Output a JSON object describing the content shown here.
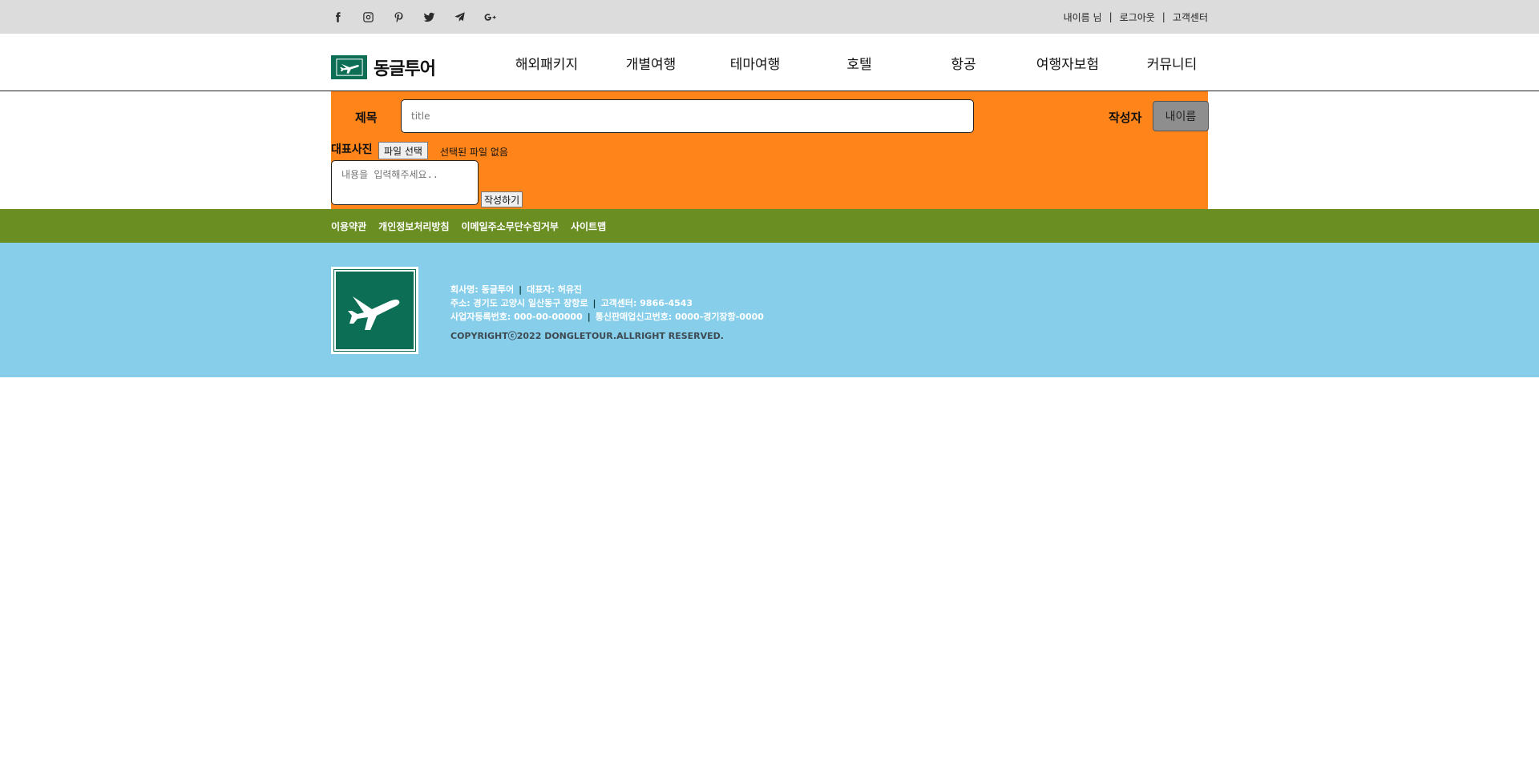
{
  "topbar": {
    "social_icons": [
      "facebook-icon",
      "instagram-icon",
      "pinterest-icon",
      "twitter-icon",
      "telegram-icon",
      "google-plus-icon"
    ],
    "user_name": "내이름 님",
    "logout": "로그아웃",
    "support": "고객센터",
    "separator": "|"
  },
  "header": {
    "logo_text": "동글투어",
    "nav": [
      "해외패키지",
      "개별여행",
      "테마여행",
      "호텔",
      "항공",
      "여행자보험",
      "커뮤니티"
    ]
  },
  "form": {
    "title_label": "제목",
    "title_placeholder": "title",
    "author_label": "작성자",
    "author_value": "내이름",
    "photo_label": "대표사진",
    "file_button": "파일 선택",
    "file_status": "선택된 파일 없음",
    "content_placeholder": "내용을 입력해주세요..",
    "submit_label": "작성하기"
  },
  "footer": {
    "links": [
      "이용약관",
      "개인정보처리방침",
      "이메일주소무단수집거부",
      "사이트맵"
    ],
    "company_label": "회사명: 동글투어",
    "ceo_label": "대표자: 허유진",
    "address_label": "주소: 경기도 고양시 일산동구 장항로",
    "support_label": "고객센터: 9866-4543",
    "business_no_label": "사업자등록번호: 000-00-00000",
    "ecommerce_no_label": "통신판매업신고번호: 0000-경기장항-0000",
    "copyright": "COPYRIGHTⓒ2022 DONGLETOUR.ALLRIGHT RESERVED.",
    "divider": "|"
  },
  "colors": {
    "topbar_bg": "#dcdcdc",
    "form_bg": "#ff851b",
    "footer_links_bg": "#6b8e23",
    "footer_bg": "#87ceeb",
    "brand_green": "#0b6e55"
  }
}
